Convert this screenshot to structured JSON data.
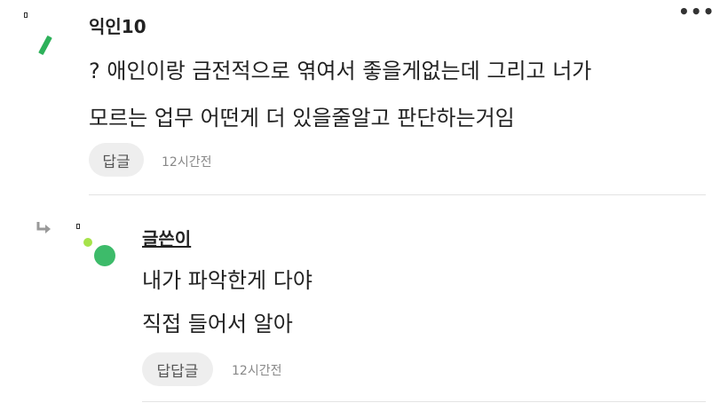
{
  "menu": {
    "icon": "more-dots-icon",
    "glyph": "•••"
  },
  "comment": {
    "author": "익인10",
    "lines": [
      "? 애인이랑 금전적으로 엮여서 좋을게없는데 그리고 너가",
      "모르는 업무 어떤게 더 있을줄알고 판단하는거임"
    ],
    "reply_label": "답글",
    "time": "12시간전"
  },
  "reply": {
    "author": "글쓴이",
    "lines": [
      "내가 파악한게 다야",
      "직접 들어서 알아"
    ],
    "reply_label": "답답글",
    "time": "12시간전"
  },
  "colors": {
    "avatar_green": "#2db15a",
    "avatar_dot_light": "#a6e34a",
    "avatar_dot_main": "#3dbb6a"
  }
}
